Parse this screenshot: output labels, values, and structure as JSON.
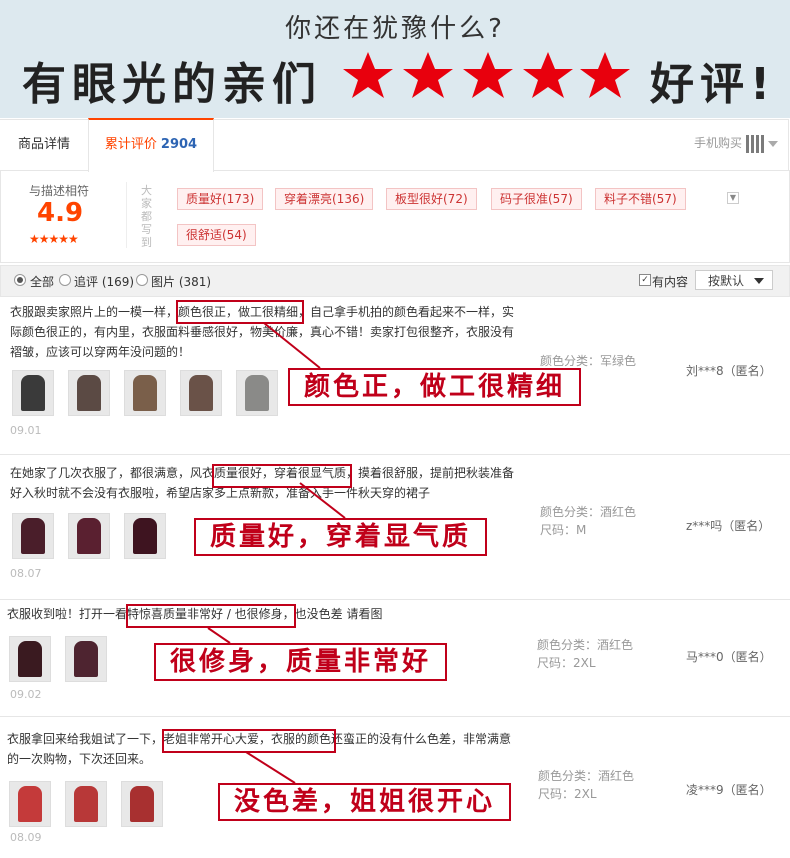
{
  "banner": {
    "subtitle": "你还在犹豫什么?",
    "title_left": "有眼光的亲们",
    "title_right": "好评!",
    "star_color": "#e8000d"
  },
  "tabs": [
    {
      "label": "商品详情"
    },
    {
      "label": "累计评价",
      "count": "2904"
    }
  ],
  "mobile_buy": "手机购买",
  "summary": {
    "score_label": "与描述相符",
    "score": "4.9",
    "stars": "★★★★★",
    "vertical_label": "大家都写到",
    "tags": [
      "质量好(173)",
      "穿着漂亮(136)",
      "板型很好(72)",
      "码子很准(57)",
      "料子不错(57)",
      "很舒适(54)"
    ]
  },
  "filters": {
    "all": "全部",
    "followup": "追评 (169)",
    "pictures": "图片 (381)",
    "has_content": "有内容",
    "sort": "按默认"
  },
  "reviews": [
    {
      "text": "衣服跟卖家照片上的一模一样，颜色很正，做工很精细，自己拿手机拍的颜色看起来不一样，实际颜色很正的，有内里，衣服面料垂感很好，物美价廉，真心不错！卖家打包很整齐，衣服没有褶皱，应该可以穿两年没问题的！",
      "date": "09.01",
      "attr1": "颜色分类：军绿色",
      "attr2": "",
      "user": "刘***8（匿名）",
      "callout": "颜色正，做工很精细"
    },
    {
      "text": "在她家了几次衣服了，都很满意，风衣质量很好，穿着很显气质，摸着很舒服，提前把秋装准备好入秋时就不会没有衣服啦，希望店家多上点新款，准备入手一件秋天穿的裙子",
      "date": "08.07",
      "attr1": "颜色分类：酒红色",
      "attr2": "尺码：M",
      "user": "z***吗（匿名）",
      "callout": "质量好，穿着显气质"
    },
    {
      "text": "衣服收到啦！打开一看特惊喜质量非常好 / 也很修身，也没色差 请看图",
      "date": "09.02",
      "attr1": "颜色分类：酒红色",
      "attr2": "尺码：2XL",
      "user": "马***0（匿名）",
      "callout": "很修身，质量非常好"
    },
    {
      "text": "衣服拿回来给我姐试了一下，老姐非常开心大爱，衣服的颜色还蛮正的没有什么色差，非常满意的一次购物，下次还回来。",
      "date": "08.09",
      "attr1": "颜色分类：酒红色",
      "attr2": "尺码：2XL",
      "user": "凌***9（匿名）",
      "callout": "没色差，姐姐很开心"
    }
  ],
  "thumb_colors": [
    "#3a3a3a",
    "#5b4a44",
    "#7a5f4a",
    "#6a5248",
    "#8a8a88",
    "#4a1e2a",
    "#5a2030",
    "#3e1420",
    "#c43a3a"
  ]
}
